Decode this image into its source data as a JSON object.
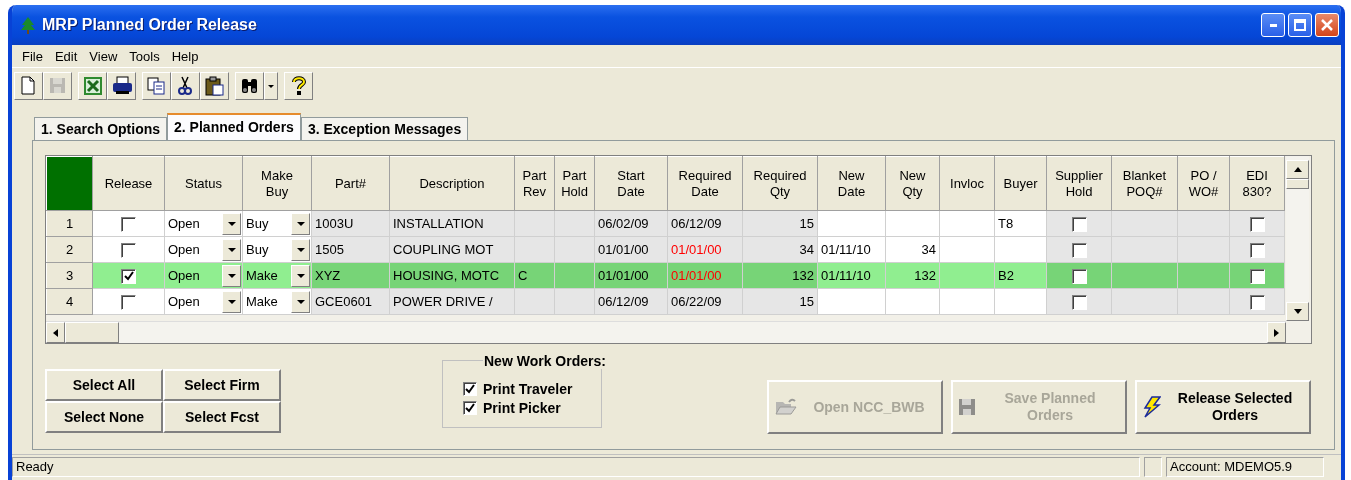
{
  "window": {
    "title": "MRP Planned Order Release"
  },
  "menu": [
    "File",
    "Edit",
    "View",
    "Tools",
    "Help"
  ],
  "toolbar": [
    {
      "kind": "new",
      "disabled": false
    },
    {
      "kind": "save",
      "disabled": true
    },
    {
      "kind": "excel",
      "disabled": false
    },
    {
      "kind": "print",
      "disabled": false
    },
    {
      "kind": "copy",
      "disabled": false
    },
    {
      "kind": "cut",
      "disabled": false
    },
    {
      "kind": "paste",
      "disabled": false
    },
    {
      "kind": "find",
      "disabled": false
    },
    {
      "kind": "dropdown",
      "disabled": false
    },
    {
      "kind": "help",
      "disabled": false
    }
  ],
  "tabs": [
    {
      "label": "1. Search Options",
      "selected": false
    },
    {
      "label": "2. Planned Orders",
      "selected": true
    },
    {
      "label": "3. Exception Messages",
      "selected": false
    }
  ],
  "grid": {
    "columns": [
      {
        "label": "Release",
        "kind": "check",
        "editable": true
      },
      {
        "label": "Status",
        "kind": "combo",
        "editable": true
      },
      {
        "label": "Make\nBuy",
        "kind": "combo",
        "editable": true
      },
      {
        "label": "Part#",
        "kind": "text",
        "editable": false
      },
      {
        "label": "Description",
        "kind": "text",
        "editable": false
      },
      {
        "label": "Part\nRev",
        "kind": "text",
        "editable": false
      },
      {
        "label": "Part\nHold",
        "kind": "text",
        "editable": false
      },
      {
        "label": "Start\nDate",
        "kind": "text",
        "editable": false
      },
      {
        "label": "Required\nDate",
        "kind": "text",
        "editable": false
      },
      {
        "label": "Required\nQty",
        "kind": "num",
        "editable": false
      },
      {
        "label": "New\nDate",
        "kind": "text",
        "editable": true
      },
      {
        "label": "New\nQty",
        "kind": "num",
        "editable": true
      },
      {
        "label": "Invloc",
        "kind": "text",
        "editable": true
      },
      {
        "label": "Buyer",
        "kind": "text",
        "editable": true
      },
      {
        "label": "Supplier\nHold",
        "kind": "check",
        "editable": false
      },
      {
        "label": "Blanket\nPOQ#",
        "kind": "text",
        "editable": false
      },
      {
        "label": "PO /\nWO#",
        "kind": "text",
        "editable": false
      },
      {
        "label": "EDI\n830?",
        "kind": "check",
        "editable": false
      }
    ],
    "rows": [
      {
        "number": "1",
        "selected": false,
        "release": false,
        "status": "Open",
        "make_buy": "Buy",
        "part": "1003U",
        "description": "INSTALLATION",
        "start_date": "06/02/09",
        "required_date": "06/12/09",
        "required_date_late": false,
        "required_qty": "15",
        "buyer": "T8",
        "supplier_hold": false,
        "edi_830": false
      },
      {
        "number": "2",
        "selected": false,
        "release": false,
        "status": "Open",
        "make_buy": "Buy",
        "part": "1505",
        "description": "COUPLING MOT",
        "start_date": "01/01/00",
        "required_date": "01/01/00",
        "required_date_late": true,
        "required_qty": "34",
        "new_date": "01/11/10",
        "new_qty": "34",
        "supplier_hold": false,
        "edi_830": false
      },
      {
        "number": "3",
        "selected": true,
        "release": true,
        "status": "Open",
        "make_buy": "Make",
        "part": "XYZ",
        "description": "HOUSING, MOTC",
        "part_rev": "C",
        "start_date": "01/01/00",
        "required_date": "01/01/00",
        "required_date_late": true,
        "required_qty": "132",
        "new_date": "01/11/10",
        "new_qty": "132",
        "buyer": "B2",
        "supplier_hold": false,
        "edi_830": false
      },
      {
        "number": "4",
        "selected": false,
        "release": false,
        "status": "Open",
        "make_buy": "Make",
        "part": "GCE0601",
        "description": "POWER DRIVE /",
        "start_date": "06/12/09",
        "required_date": "06/22/09",
        "required_date_late": false,
        "required_qty": "15",
        "supplier_hold": false,
        "edi_830": false
      }
    ]
  },
  "select_buttons": [
    "Select All",
    "Select Firm",
    "Select None",
    "Select Fcst"
  ],
  "new_work_orders": {
    "title": "New Work Orders:",
    "options": [
      {
        "label": "Print Traveler",
        "checked": true
      },
      {
        "label": "Print Picker",
        "checked": true
      }
    ]
  },
  "actions": [
    {
      "label": "Open NCC_BWB",
      "kind": "open",
      "disabled": true
    },
    {
      "label": "Save Planned\nOrders",
      "kind": "save",
      "disabled": true
    },
    {
      "label": "Release Selected\nOrders",
      "kind": "release",
      "disabled": false
    }
  ],
  "status_bar": {
    "message": "Ready",
    "account": "Account: MDEMO5.9"
  }
}
